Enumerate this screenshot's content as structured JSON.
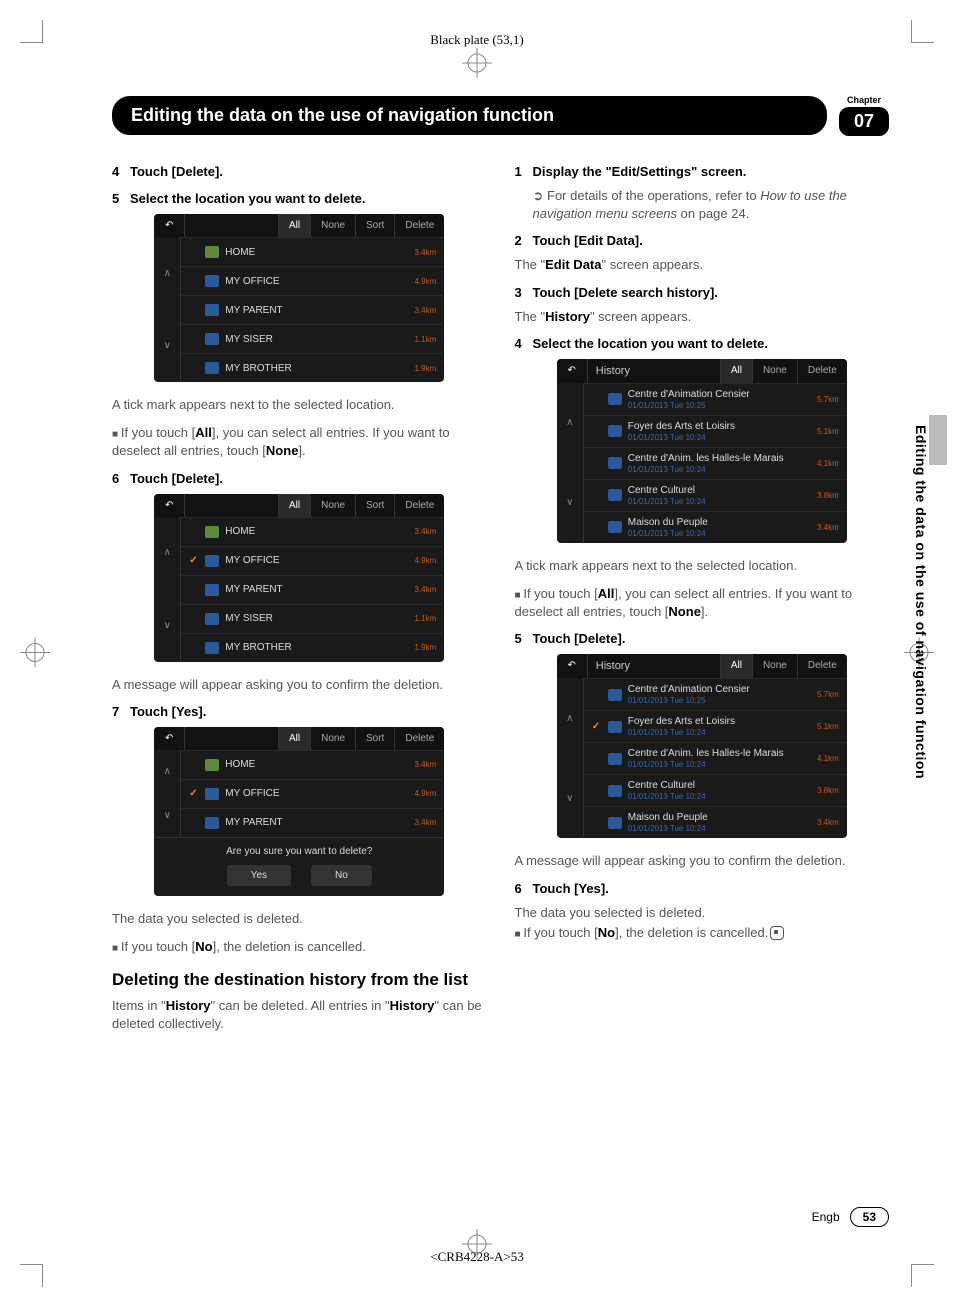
{
  "plate": "Black plate (53,1)",
  "banner": "Editing the data on the use of navigation function",
  "chapter_label": "Chapter",
  "chapter_num": "07",
  "side_tab": "Editing the data on the use of navigation function",
  "left": {
    "s4": {
      "num": "4",
      "txt": "Touch [Delete]."
    },
    "s5": {
      "num": "5",
      "txt": "Select the location you want to delete."
    },
    "ss1": {
      "btns": [
        "All",
        "None",
        "Sort",
        "Delete"
      ],
      "rows": [
        {
          "name": "HOME",
          "dist": "3.4km",
          "type": "home"
        },
        {
          "name": "MY OFFICE",
          "dist": "4.9km",
          "type": "fav"
        },
        {
          "name": "MY PARENT",
          "dist": "3.4km",
          "type": "fav"
        },
        {
          "name": "MY SISER",
          "dist": "1.1km",
          "type": "fav"
        },
        {
          "name": "MY BROTHER",
          "dist": "1.9km",
          "type": "fav"
        }
      ]
    },
    "tick": "A tick mark appears next to the selected location.",
    "all_note_a": "If you touch [",
    "all_note_b": "], you can select all entries. If you want to deselect all entries, touch [",
    "all_note_c": "].",
    "s6": {
      "num": "6",
      "txt": "Touch [Delete]."
    },
    "ss2": {
      "btns": [
        "All",
        "None",
        "Sort",
        "Delete"
      ],
      "rows": [
        {
          "name": "HOME",
          "dist": "3.4km",
          "type": "home"
        },
        {
          "name": "MY OFFICE",
          "dist": "4.9km",
          "type": "fav",
          "checked": true
        },
        {
          "name": "MY PARENT",
          "dist": "3.4km",
          "type": "fav"
        },
        {
          "name": "MY SISER",
          "dist": "1.1km",
          "type": "fav"
        },
        {
          "name": "MY BROTHER",
          "dist": "1.9km",
          "type": "fav"
        }
      ]
    },
    "confirm_msg": "A message will appear asking you to confirm the deletion.",
    "s7": {
      "num": "7",
      "txt": "Touch [Yes]."
    },
    "ss3": {
      "btns": [
        "All",
        "None",
        "Sort",
        "Delete"
      ],
      "rows": [
        {
          "name": "HOME",
          "dist": "3.4km",
          "type": "home"
        },
        {
          "name": "MY OFFICE",
          "dist": "4.9km",
          "type": "fav",
          "checked": true
        },
        {
          "name": "MY PARENT",
          "dist": "3.4km",
          "type": "fav"
        }
      ],
      "confirm": "Are you sure you want to delete?",
      "yes": "Yes",
      "no": "No"
    },
    "deleted": "The data you selected is deleted.",
    "no_note_a": "If you touch [",
    "no_note_b": "], the deletion is cancelled.",
    "section": "Deleting the destination history from the list",
    "section_body_a": "Items in \"",
    "section_body_b": "\" can be deleted. All entries in \"",
    "section_body_c": "\" can be deleted collectively."
  },
  "right": {
    "s1": {
      "num": "1",
      "txt": "Display the \"Edit/Settings\" screen."
    },
    "s1_note_a": "For details of the operations, refer to ",
    "s1_note_b": "How to use the navigation menu screens",
    "s1_note_c": " on page 24.",
    "s2": {
      "num": "2",
      "txt": "Touch [Edit Data]."
    },
    "s2_body_a": "The \"",
    "s2_body_b": "\" screen appears.",
    "s2_bold": "Edit Data",
    "s3": {
      "num": "3",
      "txt": "Touch [Delete search history]."
    },
    "s3_body_a": "The \"",
    "s3_body_b": "\" screen appears.",
    "s3_bold": "History",
    "s4": {
      "num": "4",
      "txt": "Select the location you want to delete."
    },
    "ss1": {
      "title": "History",
      "btns": [
        "All",
        "None",
        "Delete"
      ],
      "rows": [
        {
          "name": "Centre d'Animation Censier",
          "sub": "01/01/2013  Tue  10:25",
          "dist": "5.7km"
        },
        {
          "name": "Foyer des Arts et Loisirs",
          "sub": "01/01/2013  Tue  10:24",
          "dist": "5.1km"
        },
        {
          "name": "Centre d'Anim. les Halles-le Marais",
          "sub": "01/01/2013  Tue  10:24",
          "dist": "4.1km"
        },
        {
          "name": "Centre Culturel",
          "sub": "01/01/2013  Tue  10:24",
          "dist": "3.8km"
        },
        {
          "name": "Maison du Peuple",
          "sub": "01/01/2013  Tue  10:24",
          "dist": "3.4km"
        }
      ]
    },
    "tick": "A tick mark appears next to the selected location.",
    "all_note_a": "If you touch [",
    "all_note_b": "], you can select all entries. If you want to deselect all entries, touch [",
    "all_note_c": "].",
    "s5": {
      "num": "5",
      "txt": "Touch [Delete]."
    },
    "ss2": {
      "title": "History",
      "btns": [
        "All",
        "None",
        "Delete"
      ],
      "rows": [
        {
          "name": "Centre d'Animation Censier",
          "sub": "01/01/2013  Tue  10:25",
          "dist": "5.7km"
        },
        {
          "name": "Foyer des Arts et Loisirs",
          "sub": "01/01/2013  Tue  10:24",
          "dist": "5.1km",
          "checked": true
        },
        {
          "name": "Centre d'Anim. les Halles-le Marais",
          "sub": "01/01/2013  Tue  10:24",
          "dist": "4.1km"
        },
        {
          "name": "Centre Culturel",
          "sub": "01/01/2013  Tue  10:24",
          "dist": "3.8km"
        },
        {
          "name": "Maison du Peuple",
          "sub": "01/01/2013  Tue  10:24",
          "dist": "3.4km"
        }
      ]
    },
    "confirm_msg": "A message will appear asking you to confirm the deletion.",
    "s6": {
      "num": "6",
      "txt": "Touch [Yes]."
    },
    "deleted": "The data you selected is deleted.",
    "no_note_a": "If you touch [",
    "no_note_b": "], the deletion is cancelled."
  },
  "labels": {
    "all": "All",
    "none": "None",
    "history": "History",
    "no": "No"
  },
  "footer": {
    "lang": "Engb",
    "page": "53"
  },
  "docid": "<CRB4228-A>53"
}
